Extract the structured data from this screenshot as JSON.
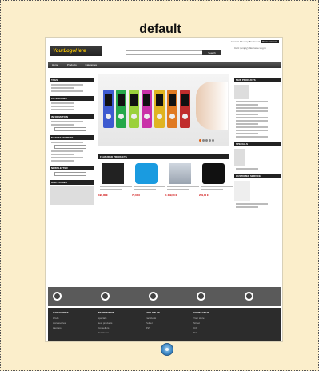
{
  "theme": {
    "title": "default",
    "thumbnail": {
      "logo_text": "YourLogoHere",
      "top_links": {
        "text": "Contact Sitemap Bookmark",
        "highlight": "Your account"
      },
      "search_button": "Search",
      "cart_text": "Cart: (empty) Welcome Log in",
      "nav_items": [
        "Home",
        "Products",
        "Categories"
      ],
      "left_boxes": [
        "TAGS",
        "CATEGORIES",
        "INFORMATION",
        "MANUFACTURERS",
        "NEWSLETTER",
        "OUR STORES"
      ],
      "featured_heading": "FEATURED PRODUCTS",
      "prices": [
        "199,00 €",
        "79,00 €",
        "1 499,00 €",
        "299,00 €"
      ],
      "right_boxes": [
        "NEW PRODUCTS",
        "SPECIALS",
        "CUSTOMER SERVICE"
      ],
      "footer_columns": [
        {
          "heading": "CATEGORIES",
          "items": [
            "iPods",
            "Accessories",
            "Laptops"
          ]
        },
        {
          "heading": "INFORMATION",
          "items": [
            "Specials",
            "New products",
            "Top sellers",
            "Our stores"
          ]
        },
        {
          "heading": "FOLLOW US",
          "items": [
            "Facebook",
            "Twitter",
            "RSS"
          ]
        },
        {
          "heading": "CONTACT US",
          "items": [
            "Your store",
            "Street",
            "City",
            "Tel"
          ]
        }
      ],
      "ipod_colors": [
        "#3e5bd0",
        "#25a84a",
        "#9bd13b",
        "#c931a8",
        "#e0b422",
        "#e07a22",
        "#c02d2d"
      ]
    }
  },
  "colors": {
    "card_background": "#fbeecb",
    "preview_button": "#3b86c4"
  },
  "actions": {
    "preview_icon": "preview-eye-icon"
  }
}
